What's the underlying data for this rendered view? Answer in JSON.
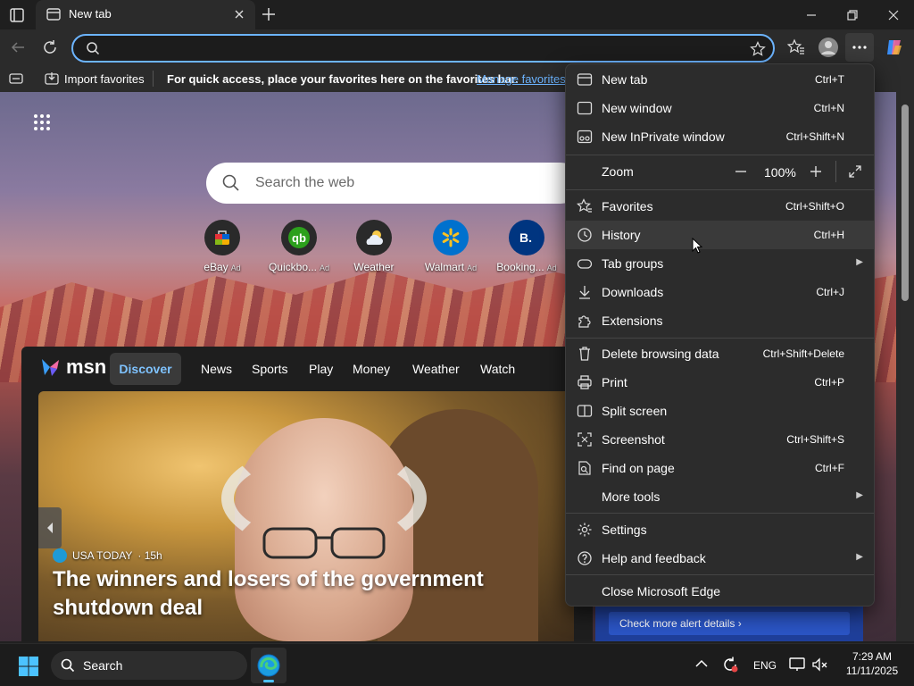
{
  "browser": {
    "tab_title": "New tab",
    "address_value": "",
    "address_placeholder": ""
  },
  "favorites_bar": {
    "import_label": "Import favorites",
    "hint": "For quick access, place your favorites here on the favorites bar.",
    "manage_link": "Manage favorites"
  },
  "newtab": {
    "search_placeholder": "Search the web",
    "quick_links": [
      {
        "label": "eBay",
        "ad": "Ad",
        "icon": "ebay-icon"
      },
      {
        "label": "Quickbo...",
        "ad": "Ad",
        "icon": "quickbooks-icon"
      },
      {
        "label": "Weather",
        "ad": "",
        "icon": "weather-icon"
      },
      {
        "label": "Walmart",
        "ad": "Ad",
        "icon": "walmart-icon"
      },
      {
        "label": "Booking...",
        "ad": "Ad",
        "icon": "booking-icon"
      }
    ],
    "msn_logo": "msn",
    "nav": [
      "Discover",
      "News",
      "Sports",
      "Play",
      "Money",
      "Weather",
      "Watch"
    ],
    "story": {
      "source": "USA TODAY",
      "age": "· 15h",
      "headline": "The winners and losers of the government shutdown deal"
    },
    "alert_button": "Check more alert details"
  },
  "menu": {
    "items": [
      {
        "label": "New tab",
        "shortcut": "Ctrl+T"
      },
      {
        "label": "New window",
        "shortcut": "Ctrl+N"
      },
      {
        "label": "New InPrivate window",
        "shortcut": "Ctrl+Shift+N"
      },
      {
        "label": "Zoom",
        "value": "100%"
      },
      {
        "label": "Favorites",
        "shortcut": "Ctrl+Shift+O"
      },
      {
        "label": "History",
        "shortcut": "Ctrl+H"
      },
      {
        "label": "Tab groups",
        "shortcut": ""
      },
      {
        "label": "Downloads",
        "shortcut": "Ctrl+J"
      },
      {
        "label": "Extensions",
        "shortcut": ""
      },
      {
        "label": "Delete browsing data",
        "shortcut": "Ctrl+Shift+Delete"
      },
      {
        "label": "Print",
        "shortcut": "Ctrl+P"
      },
      {
        "label": "Split screen",
        "shortcut": ""
      },
      {
        "label": "Screenshot",
        "shortcut": "Ctrl+Shift+S"
      },
      {
        "label": "Find on page",
        "shortcut": "Ctrl+F"
      },
      {
        "label": "More tools",
        "shortcut": ""
      },
      {
        "label": "Settings",
        "shortcut": ""
      },
      {
        "label": "Help and feedback",
        "shortcut": ""
      },
      {
        "label": "Close Microsoft Edge",
        "shortcut": ""
      }
    ]
  },
  "taskbar": {
    "search_label": "Search",
    "language": "ENG",
    "time": "7:29 AM",
    "date": "11/11/2025"
  },
  "colors": {
    "accent": "#6cb4ff",
    "menu_bg": "#2c2c2c",
    "taskbar_bg": "#1c1c1c",
    "alert_bg": "#1f3f9a"
  }
}
